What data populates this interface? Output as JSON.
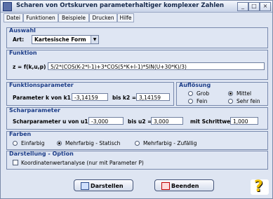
{
  "window": {
    "title": "Scharen von Ortskurven parameterhaltiger komplexer Zahlen",
    "minimize": "_",
    "maximize": "□",
    "close": "×"
  },
  "menu": [
    {
      "label": "Datei"
    },
    {
      "label": "Funktionen"
    },
    {
      "label": "Beispiele"
    },
    {
      "label": "Drucken"
    },
    {
      "label": "Hilfe"
    }
  ],
  "auswahl": {
    "title": "Auswahl",
    "art_label": "Art:",
    "art_value": "Kartesische Form",
    "arrow": "▼"
  },
  "funktion": {
    "title": "Funktion",
    "label": "z = f(k,u,p) =",
    "value": "5/2*(COS(K-2*I-1)+3*COS(5*K+I-1)*SIN(U+30*K)/3)"
  },
  "funktionsparameter": {
    "title": "Funktionsparameter",
    "k_label": "Parameter k von k1 =",
    "k1": "-3,14159",
    "bis_label": "bis k2 =",
    "k2": "3,14159"
  },
  "aufloesung": {
    "title": "Auflösung",
    "options": [
      {
        "label": "Grob",
        "selected": false
      },
      {
        "label": "Mittel",
        "selected": true
      },
      {
        "label": "Fein",
        "selected": false
      },
      {
        "label": "Sehr fein",
        "selected": false
      }
    ]
  },
  "scharparameter": {
    "title": "Scharparameter",
    "u_label": "Scharparameter u von u1 =",
    "u1": "-3,000",
    "bis_label": "bis u2 =",
    "u2": "3,000",
    "schritt_label": "mit Schrittweite:",
    "schritt": "1,000"
  },
  "farben": {
    "title": "Farben",
    "options": [
      {
        "label": "Einfarbig",
        "selected": false
      },
      {
        "label": "Mehrfarbig - Statisch",
        "selected": true
      },
      {
        "label": "Mehrfarbig - Zufällig",
        "selected": false
      }
    ]
  },
  "darstellung": {
    "title": "Darstellung - Option",
    "checkbox_label": "Koordinatenwertanalyse (nur mit Parameter P)",
    "checked": false
  },
  "buttons": {
    "darstellen": "Darstellen",
    "beenden": "Beenden",
    "help": "?"
  }
}
